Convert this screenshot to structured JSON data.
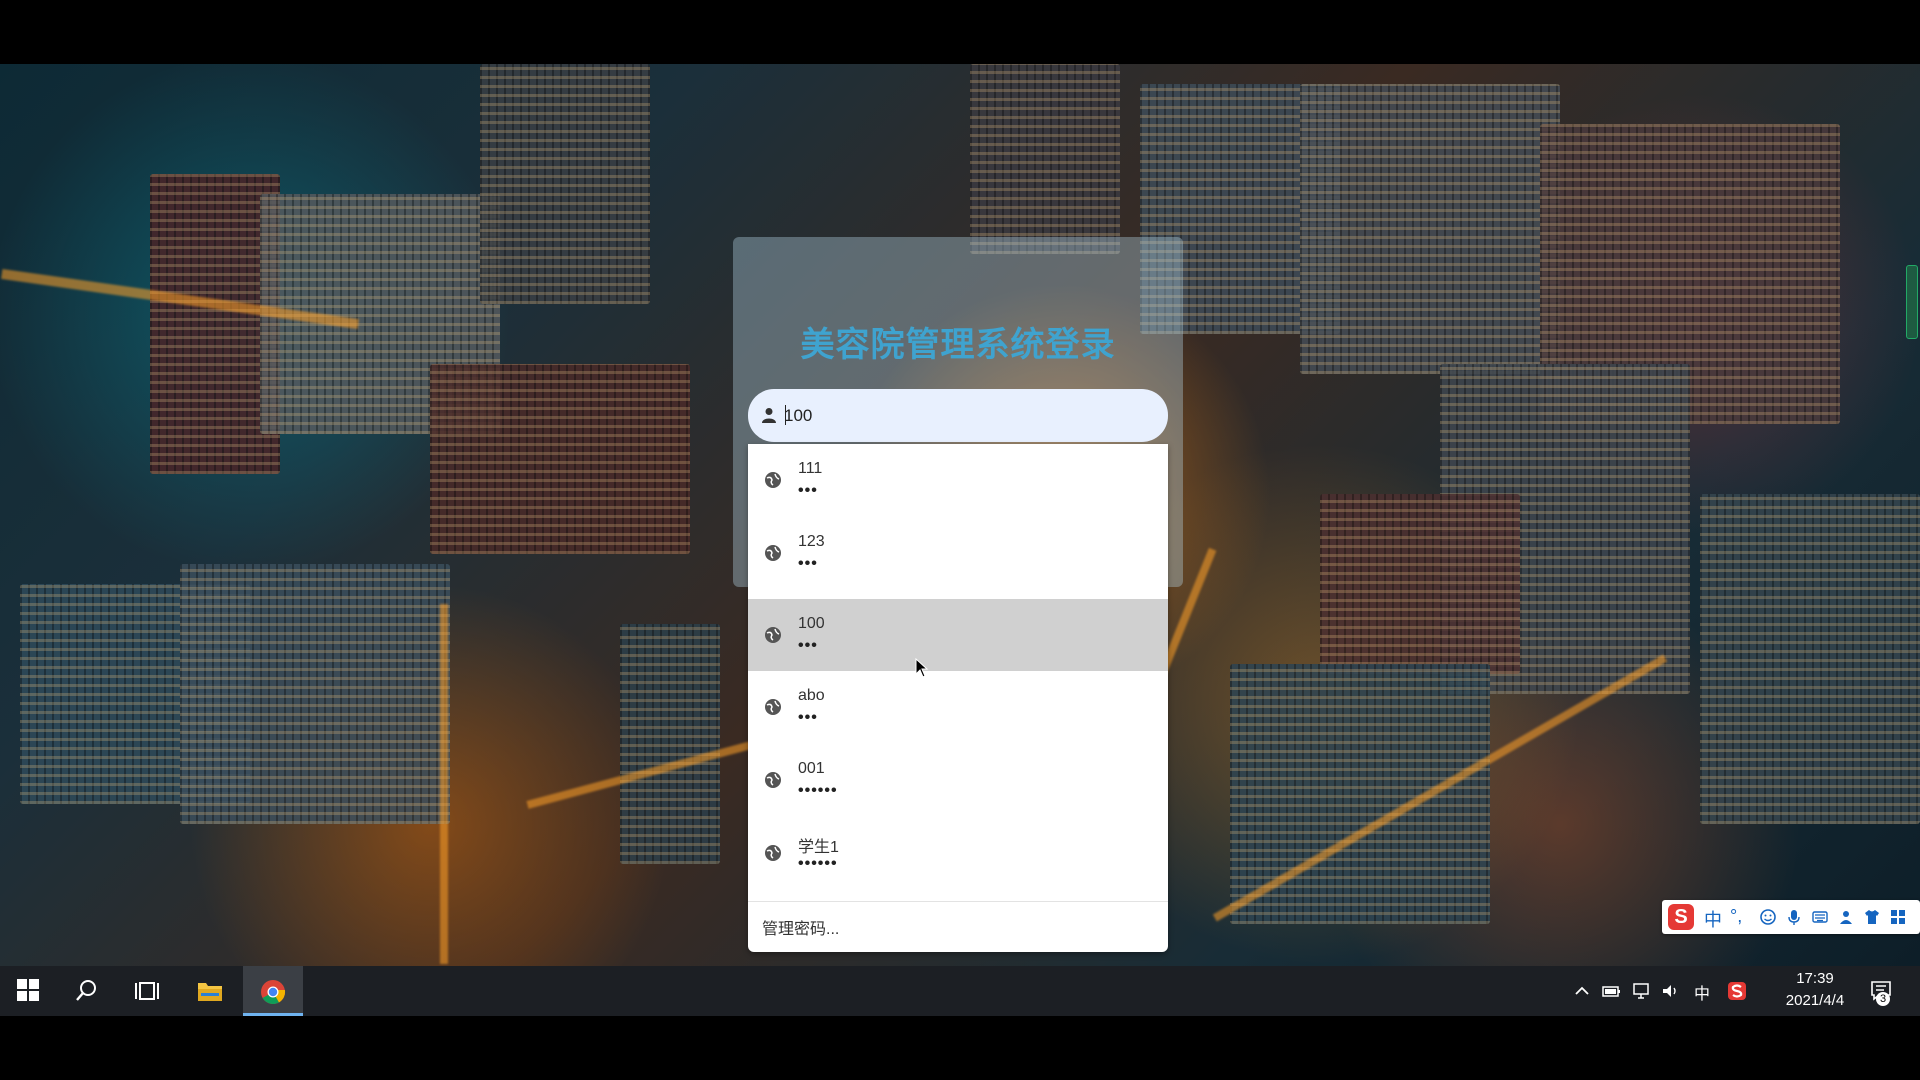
{
  "login": {
    "title": "美容院管理系统登录",
    "username_value": "100"
  },
  "autofill": {
    "items": [
      {
        "username": "111",
        "password_mask": "•••"
      },
      {
        "username": "123",
        "password_mask": "•••"
      },
      {
        "username": "100",
        "password_mask": "•••"
      },
      {
        "username": "abo",
        "password_mask": "•••"
      },
      {
        "username": "001",
        "password_mask": "••••••"
      },
      {
        "username": "学生1",
        "password_mask": "••••••"
      }
    ],
    "highlighted_index": 2,
    "manage_label": "管理密码..."
  },
  "ime": {
    "logo": "S",
    "mode": "中",
    "punct": "°,"
  },
  "taskbar": {
    "tray_lang": "中",
    "time": "17:39",
    "date": "2021/4/4",
    "notification_count": "3"
  },
  "colors": {
    "title": "#3fa3cf",
    "field_bg": "#e8f0fe",
    "highlight_row": "#d0d0d0",
    "taskbar_bg": "#1c1f24"
  },
  "icons": [
    "user-icon",
    "globe-key-icon",
    "windows-start-icon",
    "search-icon",
    "task-view-icon",
    "file-explorer-icon",
    "chrome-icon",
    "chevron-up-icon",
    "battery-icon",
    "network-icon",
    "volume-icon",
    "sogou-icon",
    "notification-icon"
  ]
}
